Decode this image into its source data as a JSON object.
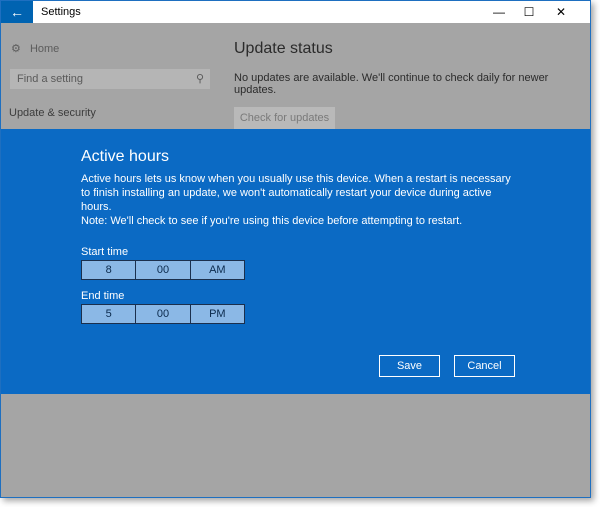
{
  "window": {
    "title": "Settings",
    "back_icon": "←",
    "minimize_icon": "—",
    "maximize_icon": "☐",
    "close_icon": "✕"
  },
  "sidebar": {
    "home_icon": "⚙",
    "home_label": "Home",
    "search_placeholder": "Find a setting",
    "search_icon": "⚲",
    "category": "Update & security"
  },
  "main": {
    "title": "Update status",
    "message": "No updates are available. We'll continue to check daily for newer updates.",
    "check_button": "Check for updates"
  },
  "dialog": {
    "title": "Active hours",
    "description": "Active hours lets us know when you usually use this device. When a restart is necessary to finish installing an update, we won't automatically restart your device during active hours.",
    "note": "Note: We'll check to see if you're using this device before attempting to restart.",
    "start_label": "Start time",
    "start": {
      "hour": "8",
      "minute": "00",
      "period": "AM"
    },
    "end_label": "End time",
    "end": {
      "hour": "5",
      "minute": "00",
      "period": "PM"
    },
    "save": "Save",
    "cancel": "Cancel"
  },
  "colors": {
    "dialog_bg": "#0b6ac4",
    "accent": "#0063b1",
    "overlay": "#a5a5a5"
  }
}
